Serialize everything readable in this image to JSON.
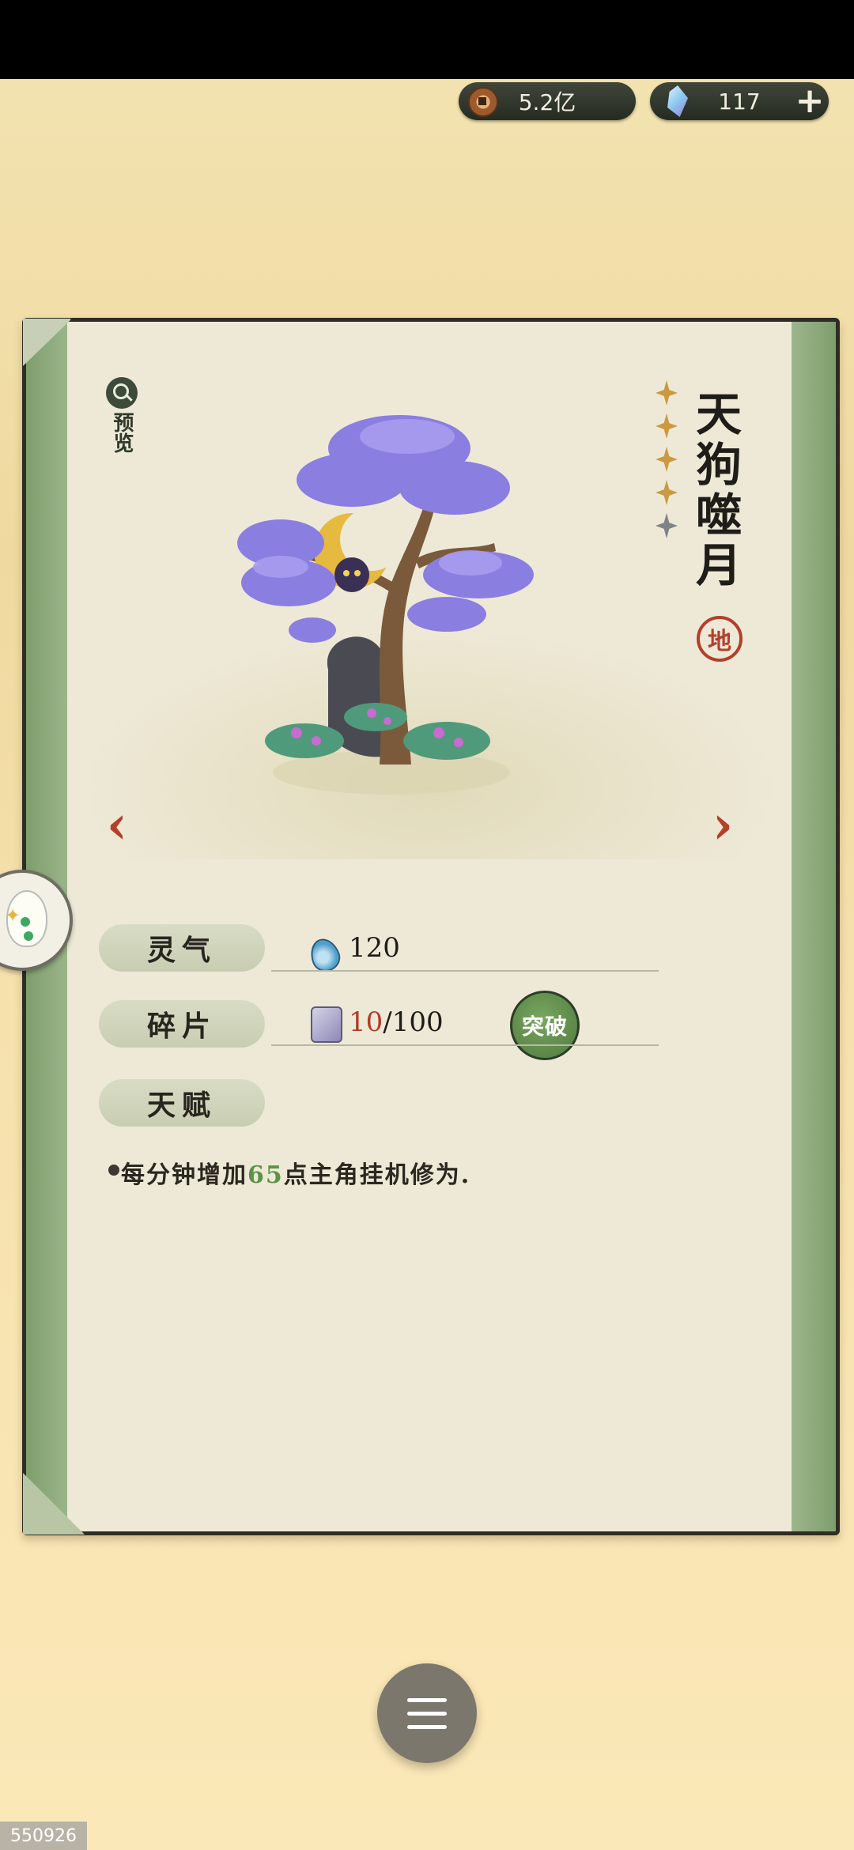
{
  "currency": {
    "coins": "5.2亿",
    "gems": "117",
    "add_label": "+"
  },
  "card": {
    "preview_label": "预览",
    "title_chars": [
      "天",
      "狗",
      "噬",
      "月"
    ],
    "grade_seal": "地",
    "stars": {
      "filled": 4,
      "total": 5
    },
    "nav_prev": "‹",
    "nav_next": "›"
  },
  "stats": {
    "spirit_label": "灵气",
    "spirit_value": "120",
    "fragment_label": "碎片",
    "fragment_current": "10",
    "fragment_total": "/100",
    "breakthrough_label": "突破",
    "talent_label": "天赋"
  },
  "talent": {
    "prefix": "每分钟增加",
    "amount": "65",
    "suffix": "点主角挂机修为."
  },
  "colors": {
    "accent_red": "#b3402c",
    "accent_green": "#5a9446",
    "card_bg": "#eee9d7"
  },
  "footer": {
    "watermark": "550926"
  }
}
